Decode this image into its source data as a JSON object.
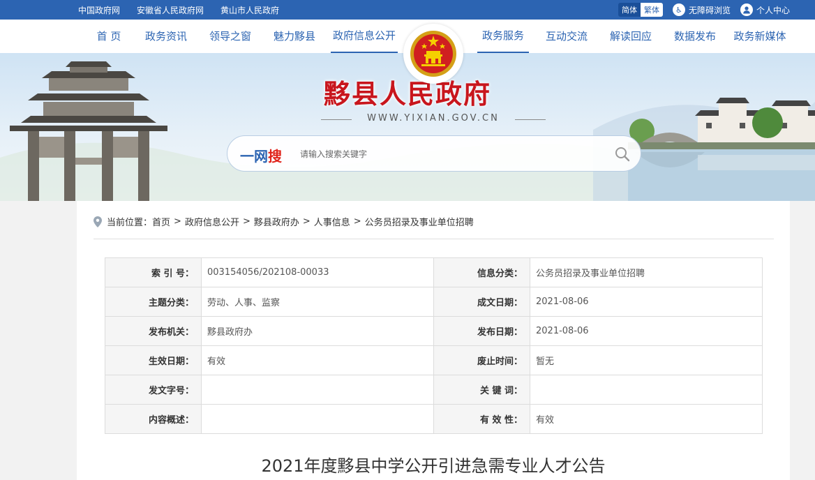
{
  "topbar": {
    "links": [
      "中国政府网",
      "安徽省人民政府网",
      "黄山市人民政府"
    ],
    "lang_simplified": "简体",
    "lang_traditional": "繁体",
    "accessibility": "无障碍浏览",
    "personal_center": "个人中心"
  },
  "nav": {
    "left": [
      "首 页",
      "政务资讯",
      "领导之窗",
      "魅力黟县",
      "政府信息公开"
    ],
    "right": [
      "政务服务",
      "互动交流",
      "解读回应",
      "数据发布",
      "政务新媒体"
    ],
    "active": [
      "政府信息公开",
      "政务服务"
    ]
  },
  "banner": {
    "title": "黟县人民政府",
    "url": "WWW.YIXIAN.GOV.CN"
  },
  "search": {
    "brand_prefix": "一网",
    "brand_suffix": "搜",
    "placeholder": "请输入搜索关键字"
  },
  "breadcrumb": {
    "prefix": "当前位置：",
    "items": [
      "首页",
      "政府信息公开",
      "黟县政府办",
      "人事信息",
      "公务员招录及事业单位招聘"
    ],
    "separator": ">"
  },
  "meta": [
    {
      "k1": "索 引 号：",
      "v1": "003154056/202108-00033",
      "k2": "信息分类：",
      "v2": "公务员招录及事业单位招聘"
    },
    {
      "k1": "主题分类：",
      "v1": "劳动、人事、监察",
      "k2": "成文日期：",
      "v2": "2021-08-06"
    },
    {
      "k1": "发布机关：",
      "v1": "黟县政府办",
      "k2": "发布日期：",
      "v2": "2021-08-06"
    },
    {
      "k1": "生效日期：",
      "v1": "有效",
      "k2": "废止时间：",
      "v2": "暂无"
    },
    {
      "k1": "发文字号：",
      "v1": "",
      "k2": "关 键 词：",
      "v2": ""
    },
    {
      "k1": "内容概述：",
      "v1": "",
      "k2": "有 效 性：",
      "v2": "有效"
    }
  ],
  "article": {
    "title": "2021年度黟县中学公开引进急需专业人才公告"
  },
  "colors": {
    "primary": "#2c64b2",
    "title_red": "#c8161d",
    "search_red": "#e0241b"
  }
}
